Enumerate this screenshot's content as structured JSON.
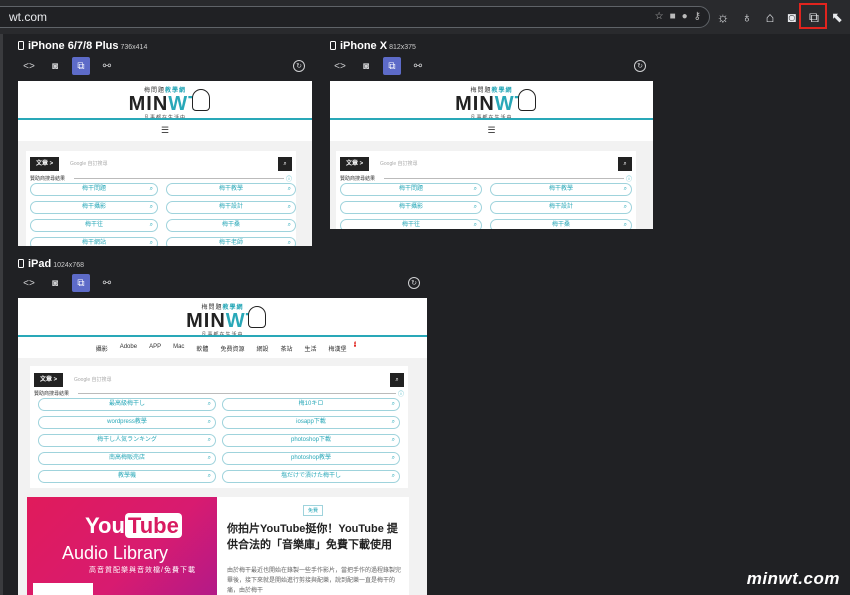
{
  "browser": {
    "url": "wt.com"
  },
  "devices": [
    {
      "name": "iPhone 6/7/8 Plus",
      "resolution": "736x414",
      "logo": {
        "small_a": "梅問題",
        "small_b": "教學網",
        "main_a": "MIN",
        "main_b": "WT",
        "sub": "凡事都在生活中"
      },
      "search": {
        "label": "文章 >",
        "placeholder": "Google 自訂搜尋",
        "button": "⌕"
      },
      "sponsor": "贊助商搜尋結果",
      "pills": [
        "梅干問題",
        "梅干教學",
        "梅干攝影",
        "梅干設計",
        "梅干往",
        "梅干桑",
        "梅干網站",
        "梅干老師"
      ]
    },
    {
      "name": "iPhone X",
      "resolution": "812x375",
      "logo": {
        "small_a": "梅問題",
        "small_b": "教學網",
        "main_a": "MIN",
        "main_b": "WT",
        "sub": "凡事都在生活中"
      },
      "search": {
        "label": "文章 >",
        "placeholder": "Google 自訂搜尋",
        "button": "⌕"
      },
      "sponsor": "贊助商搜尋結果",
      "pills": [
        "梅干問題",
        "梅干教學",
        "梅干攝影",
        "梅干設計",
        "梅干往",
        "梅干桑"
      ]
    },
    {
      "name": "iPad",
      "resolution": "1024x768",
      "logo": {
        "small_a": "梅問題",
        "small_b": "教學網",
        "main_a": "MIN",
        "main_b": "WT",
        "sub": "凡事都在生活中"
      },
      "nav": [
        "攝影",
        "Adobe",
        "APP",
        "Mac",
        "軟體",
        "免費資源",
        "網設",
        "茶站",
        "生活",
        "梅漢堡"
      ],
      "nav_badge": "1",
      "search": {
        "label": "文章 >",
        "placeholder": "Google 自訂搜尋",
        "button": "⌕"
      },
      "sponsor": "贊助商搜尋結果",
      "pills": [
        "最高級梅干し",
        "梅10キロ",
        "wordpress教學",
        "iosapp下載",
        "梅干し人気ランキング",
        "photoshop下載",
        "南高梅販売店",
        "photoshop教學",
        "教學機",
        "塩だけで漬けた梅干し"
      ],
      "article": {
        "tag": "免費",
        "banner_word_a": "You",
        "banner_word_b": "Tube",
        "banner_sub": "Audio Library",
        "banner_sub2": "高音質配樂與音效檔/免費下載",
        "title": "你拍片YouTube挺你！YouTube 提供合法的「音樂庫」免費下載使用",
        "body": "由於梅干最近也開始在錄製一些手作影片，當把手作的過程錄製完畢後，接下來就是開始進行剪接與配樂，說到配樂一直是梅干的痛，由於梅干"
      }
    }
  ],
  "watermark": "minwt.com",
  "colors": {
    "accent": "#29a8b8",
    "active_tool": "#5d6bc8",
    "highlight": "#e0241e"
  }
}
